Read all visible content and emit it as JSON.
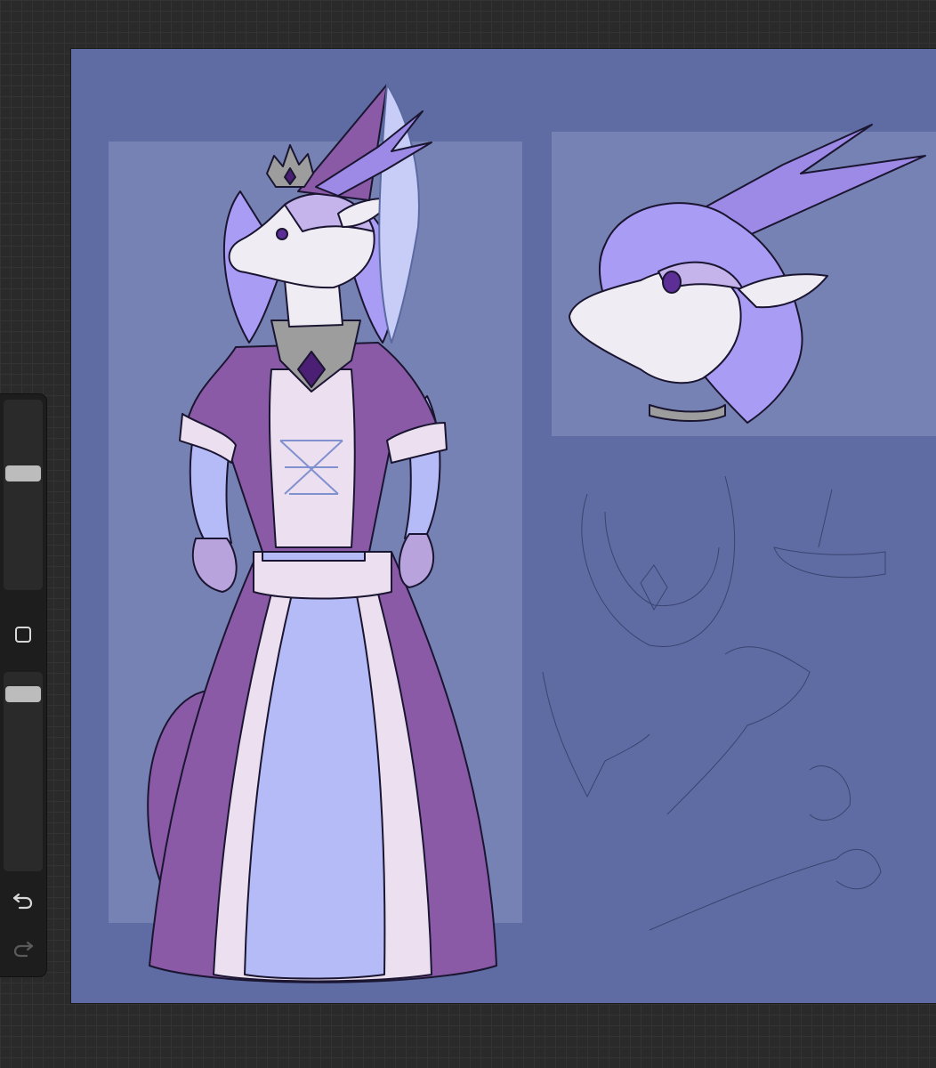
{
  "app": {
    "background_color": "#2a2a2a",
    "canvas_color": "#5e6ca3",
    "panel_color": "#7782b4"
  },
  "sidebar": {
    "brush_size": {
      "icon": "brush-size-slider",
      "level": 0.62
    },
    "modify_button": {
      "icon": "square-icon"
    },
    "brush_opacity": {
      "icon": "brush-opacity-slider",
      "level": 0.92
    },
    "undo": {
      "icon": "undo-arrow-icon"
    },
    "redo": {
      "icon": "redo-arrow-icon",
      "enabled": false
    }
  },
  "artwork": {
    "palette": {
      "fur": "#a99cf5",
      "skin": "#f0ecf4",
      "gown_dark": "#8a5aa7",
      "gown_light": "#ecdff0",
      "gown_blue": "#b5bbf6",
      "crown": "#9d9d9d",
      "gem": "#4b1f73"
    }
  }
}
